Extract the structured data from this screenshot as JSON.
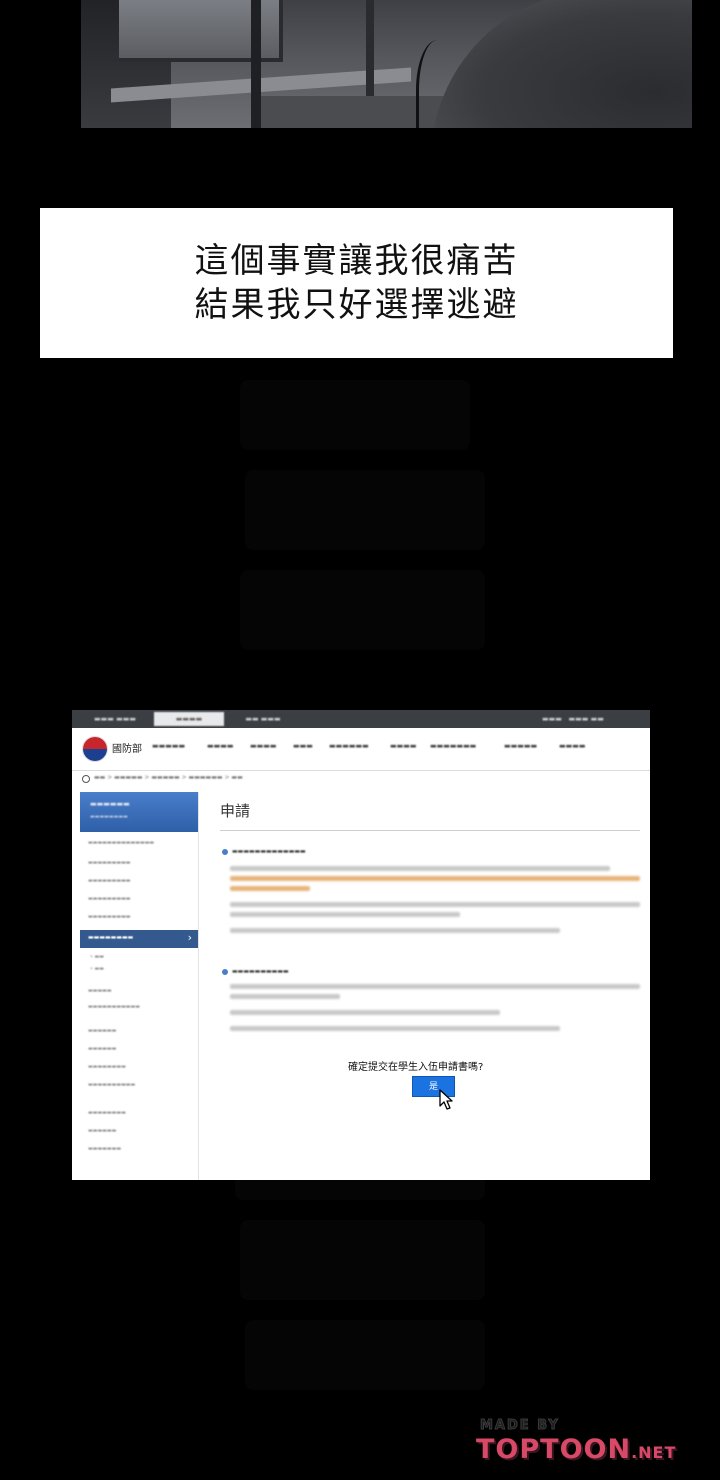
{
  "caption": {
    "line1": "這個事實讓我很痛苦",
    "line2": "結果我只好選擇逃避"
  },
  "site": {
    "logo_name": "國防部",
    "page_title": "申請",
    "dialog": {
      "message": "確定提交在學生入伍申請書嗎?",
      "confirm_label": "是"
    },
    "accent_color": "#1a73e0",
    "sidebar_color": "#33598f"
  },
  "icons": [
    "emblem-icon",
    "home-icon",
    "chevron-right-icon",
    "cursor-icon"
  ],
  "watermark": {
    "made_by": "MADE BY",
    "brand": "TOPTOON",
    "suffix": ".NET"
  }
}
